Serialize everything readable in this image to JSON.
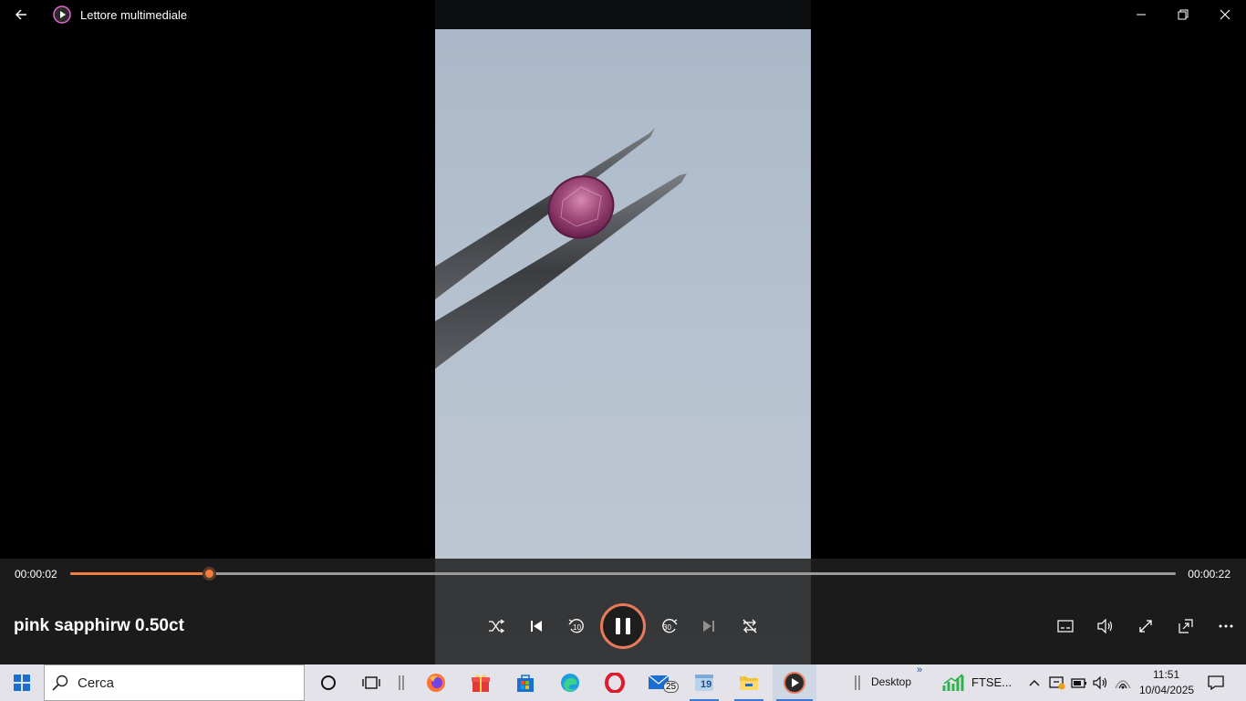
{
  "app": {
    "title": "Lettore multimediale"
  },
  "player": {
    "current_time": "00:00:02",
    "duration": "00:00:22",
    "progress_fraction": 0.125,
    "media_title": "pink sapphirw 0.50ct",
    "accent_color": "#f47c3c"
  },
  "controls": {
    "shuffle": "shuffle-icon",
    "previous": "previous-icon",
    "skip_back_label": "10",
    "play_pause": "pause-icon",
    "skip_forward_label": "30",
    "next": "next-icon",
    "repeat": "repeat-off-icon",
    "right": [
      "subtitles-icon",
      "volume-icon",
      "fullscreen-icon",
      "mini-player-icon",
      "more-icon"
    ]
  },
  "taskbar": {
    "search_placeholder": "Cerca",
    "mail_badge": "25",
    "calendar_badge": "19",
    "desktop_label": "Desktop",
    "ftse_label": "FTSE...",
    "time": "11:51",
    "date": "10/04/2025"
  }
}
